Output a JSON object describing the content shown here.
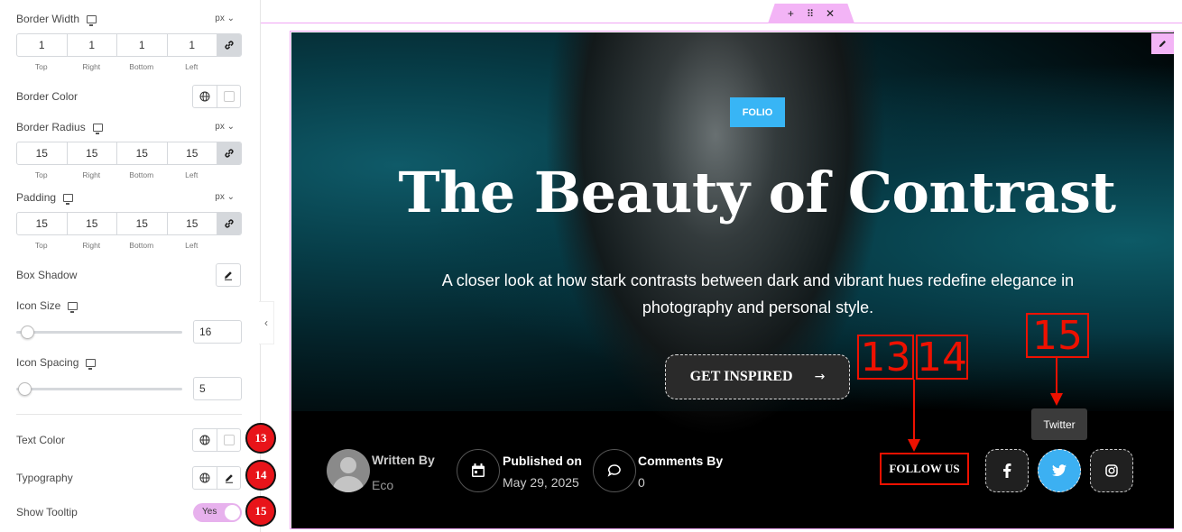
{
  "panel": {
    "border_width": {
      "label": "Border Width",
      "unit": "px",
      "values": [
        "1",
        "1",
        "1",
        "1"
      ]
    },
    "sides": [
      "Top",
      "Right",
      "Bottom",
      "Left"
    ],
    "border_color": {
      "label": "Border Color"
    },
    "border_radius": {
      "label": "Border Radius",
      "unit": "px",
      "values": [
        "15",
        "15",
        "15",
        "15"
      ]
    },
    "padding": {
      "label": "Padding",
      "unit": "px",
      "values": [
        "15",
        "15",
        "15",
        "15"
      ]
    },
    "box_shadow": {
      "label": "Box Shadow"
    },
    "icon_size": {
      "label": "Icon Size",
      "value": "16"
    },
    "icon_spacing": {
      "label": "Icon Spacing",
      "value": "5"
    },
    "text_color": {
      "label": "Text Color",
      "badge": "13"
    },
    "typography": {
      "label": "Typography",
      "badge": "14"
    },
    "show_tooltip": {
      "label": "Show Tooltip",
      "toggle": "Yes",
      "badge": "15"
    }
  },
  "hero": {
    "category": "FOLIO",
    "title": "The Beauty of Contrast",
    "description": "A closer look at how stark contrasts between dark and vibrant hues redefine elegance in photography and personal style.",
    "cta": "GET INSPIRED",
    "author_label": "Written By",
    "author": "Eco",
    "published_label": "Published on",
    "published": "May 29, 2025",
    "comments_label": "Comments By",
    "comments": "0",
    "follow": "FOLLOW US",
    "tooltip": "Twitter"
  },
  "annotations": {
    "a13": "13",
    "a14": "14",
    "a15": "15"
  },
  "colors": {
    "accent": "#38b5f5",
    "editor_pink": "#f3b4f6",
    "annotation_red": "#ee1100",
    "twitter": "#3cb0f2"
  }
}
